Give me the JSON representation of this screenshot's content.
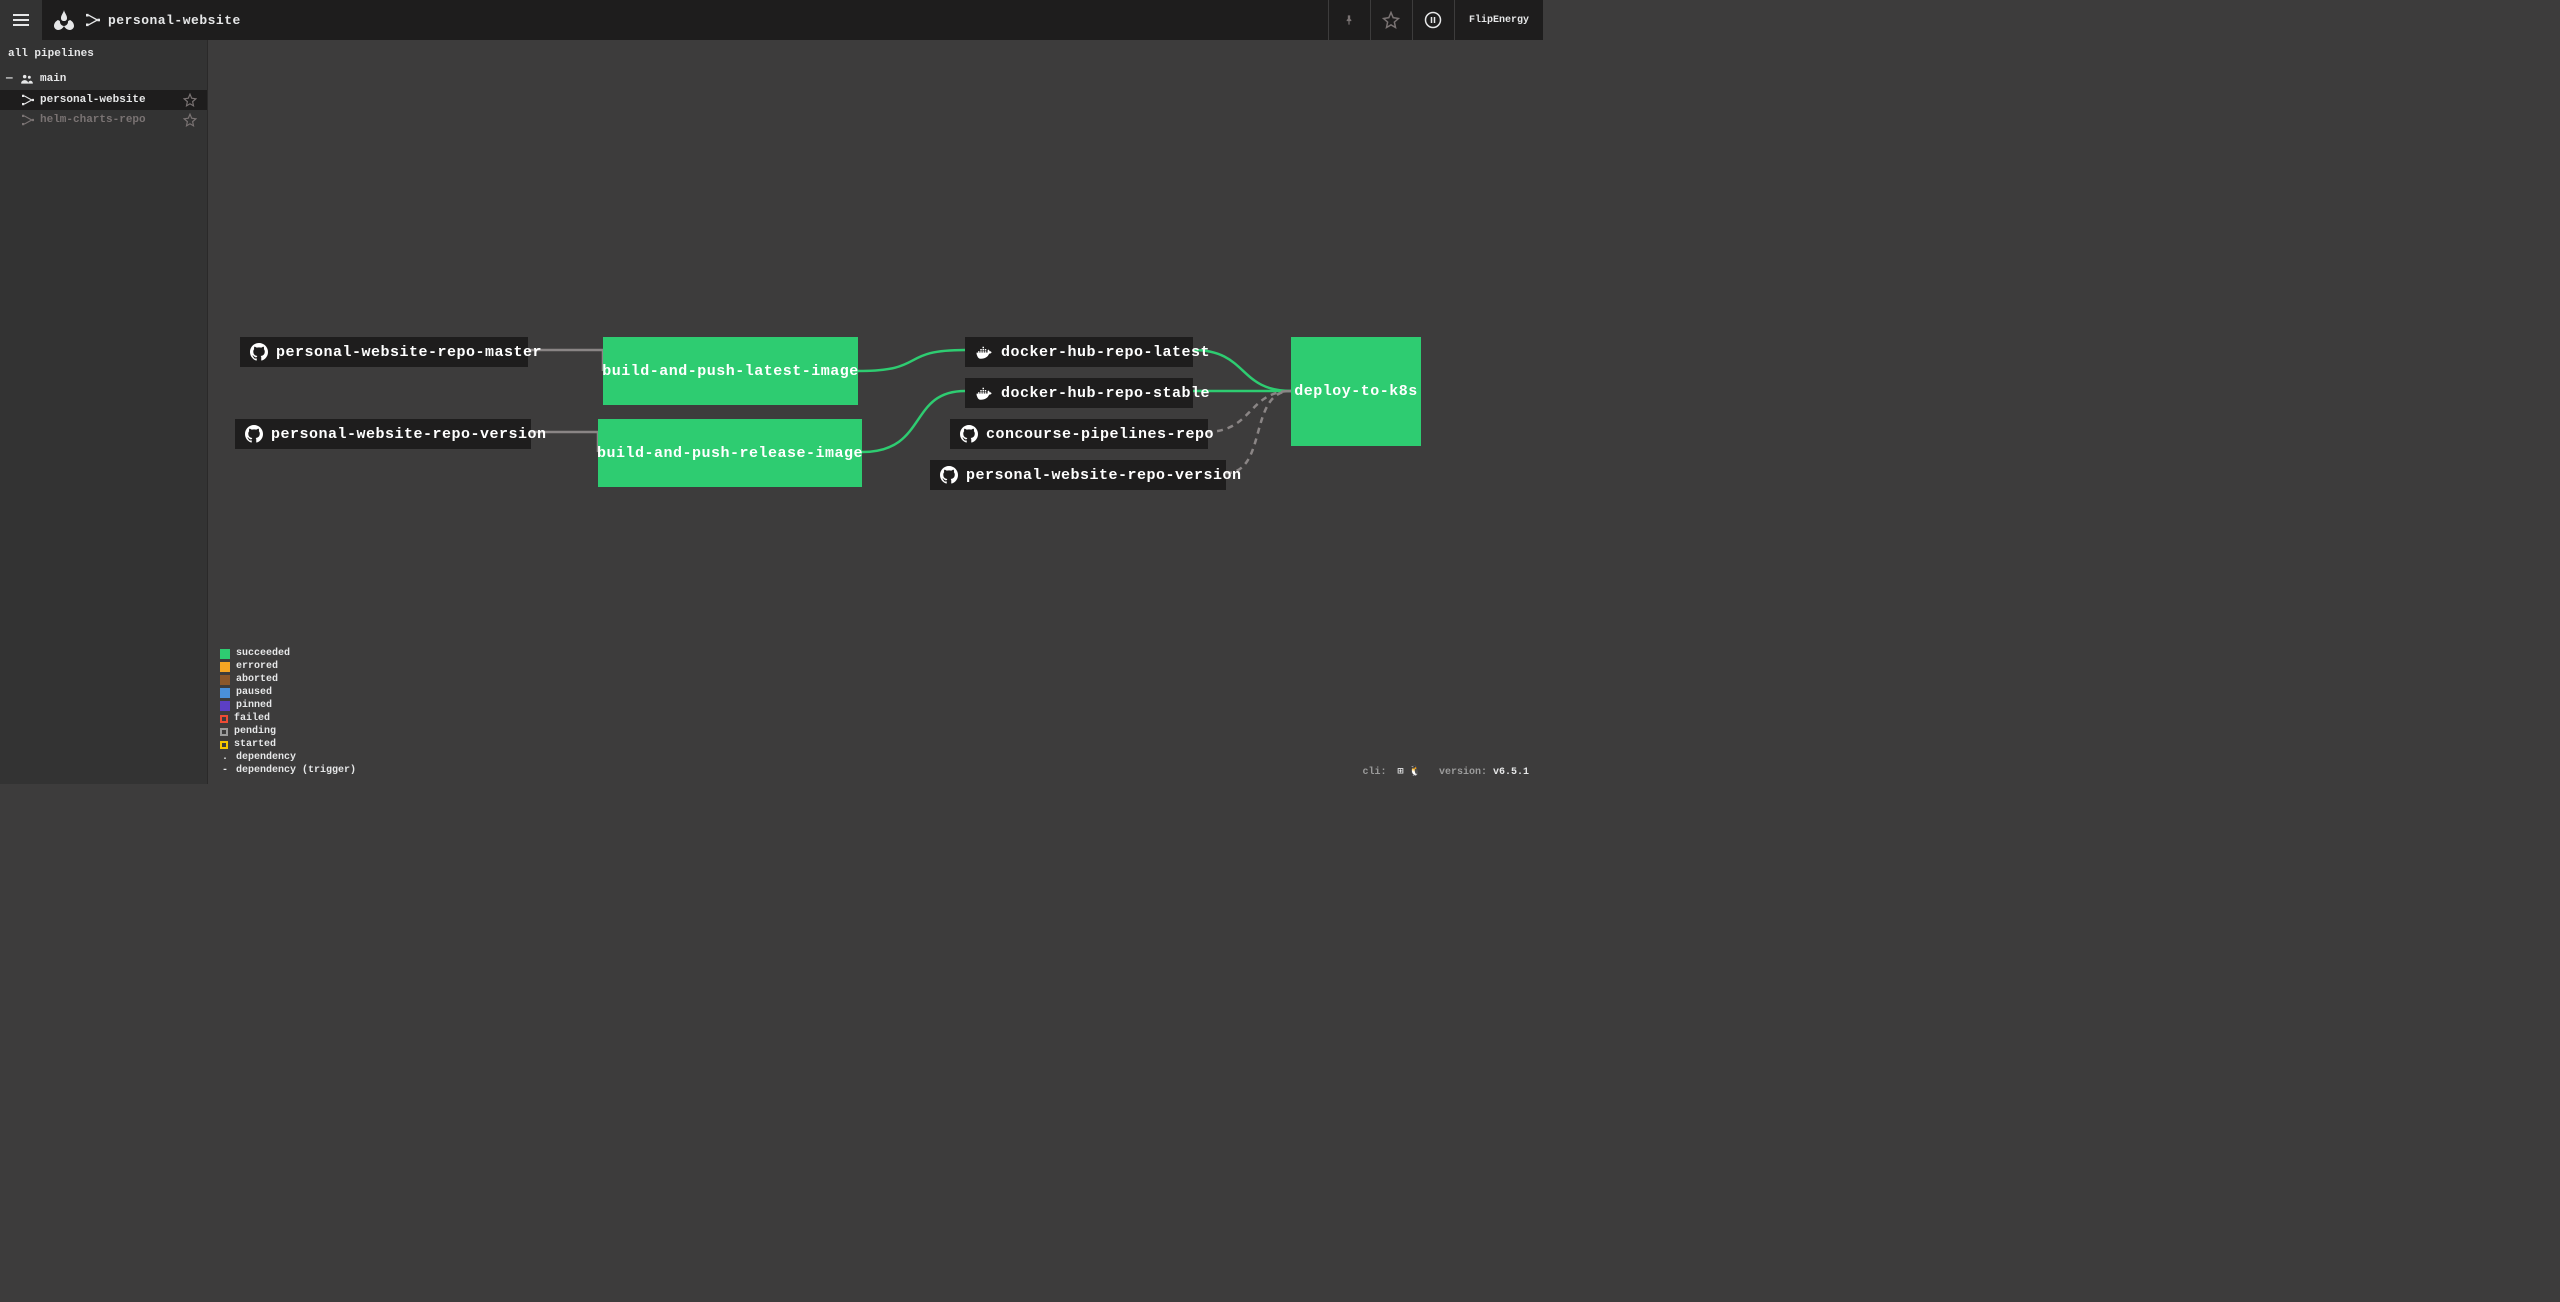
{
  "header": {
    "pipeline_name": "personal-website",
    "user": "FlipEnergy"
  },
  "sidebar": {
    "heading": "all pipelines",
    "team": "main",
    "pipelines": [
      {
        "name": "personal-website",
        "active": true
      },
      {
        "name": "helm-charts-repo",
        "active": false
      }
    ]
  },
  "graph": {
    "resources_left": [
      {
        "name": "personal-website-repo-master",
        "icon": "github"
      },
      {
        "name": "personal-website-repo-version",
        "icon": "github"
      }
    ],
    "jobs_middle": [
      {
        "name": "build-and-push-latest-image"
      },
      {
        "name": "build-and-push-release-image"
      }
    ],
    "resources_right": [
      {
        "name": "docker-hub-repo-latest",
        "icon": "docker"
      },
      {
        "name": "docker-hub-repo-stable",
        "icon": "docker"
      },
      {
        "name": "concourse-pipelines-repo",
        "icon": "github"
      },
      {
        "name": "personal-website-repo-version",
        "icon": "github"
      }
    ],
    "job_right": {
      "name": "deploy-to-k8s"
    }
  },
  "legend": {
    "succeeded": "succeeded",
    "errored": "errored",
    "aborted": "aborted",
    "paused": "paused",
    "pinned": "pinned",
    "failed": "failed",
    "pending": "pending",
    "started": "started",
    "dependency": "dependency",
    "dependency_trigger": "dependency (trigger)"
  },
  "footer": {
    "cli_label": "cli:",
    "version_label": "version:",
    "version_value": "v6.5.1"
  }
}
